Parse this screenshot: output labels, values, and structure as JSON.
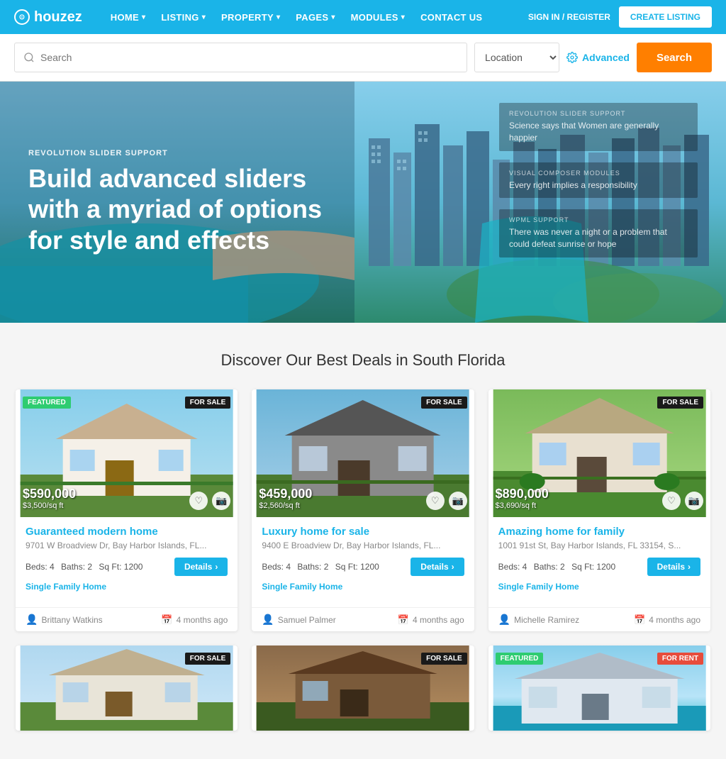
{
  "brand": {
    "name": "houzez",
    "logo_icon": "⊙"
  },
  "navbar": {
    "links": [
      {
        "label": "HOME",
        "has_dropdown": true
      },
      {
        "label": "LISTING",
        "has_dropdown": true
      },
      {
        "label": "PROPERTY",
        "has_dropdown": true
      },
      {
        "label": "PAGES",
        "has_dropdown": true
      },
      {
        "label": "MODULES",
        "has_dropdown": true
      },
      {
        "label": "CONTACT US",
        "has_dropdown": false
      }
    ],
    "sign_in_label": "SIGN IN / REGISTER",
    "create_listing_label": "CREATE LISTING"
  },
  "search_bar": {
    "placeholder": "Search",
    "location_label": "Location",
    "advanced_label": "Advanced",
    "search_button_label": "Search"
  },
  "hero": {
    "sub_label": "REVOLUTION SLIDER SUPPORT",
    "title": "Build advanced sliders with a myriad of options for style and effects",
    "panels": [
      {
        "sub": "REVOLUTION SLIDER SUPPORT",
        "title": "Science says that Women are generally happier"
      },
      {
        "sub": "VISUAL COMPOSER MODULES",
        "title": "Every right implies a responsibility"
      },
      {
        "sub": "WPML SUPPORT",
        "title": "There was never a night or a problem that could defeat sunrise or hope"
      }
    ]
  },
  "deals_section": {
    "title": "Discover Our Best Deals in South Florida"
  },
  "properties": [
    {
      "featured": true,
      "status": "FOR SALE",
      "price": "$590,000",
      "price_per_sqft": "$3,500/sq ft",
      "title": "Guaranteed modern home",
      "address": "9701 W Broadview Dr, Bay Harbor Islands, FL...",
      "beds": "4",
      "baths": "2",
      "sqft": "1200",
      "type": "Single Family Home",
      "agent": "Brittany Watkins",
      "time": "4 months ago",
      "details_label": "Details",
      "color": "#e8d5a0",
      "image_type": "white_house"
    },
    {
      "featured": false,
      "status": "FOR SALE",
      "price": "$459,000",
      "price_per_sqft": "$2,560/sq ft",
      "title": "Luxury home for sale",
      "address": "9400 E Broadview Dr, Bay Harbor Islands, FL...",
      "beds": "4",
      "baths": "2",
      "sqft": "1200",
      "type": "Single Family Home",
      "agent": "Samuel Palmer",
      "time": "4 months ago",
      "details_label": "Details",
      "color": "#c8d4b0",
      "image_type": "gray_house"
    },
    {
      "featured": false,
      "status": "FOR SALE",
      "price": "$890,000",
      "price_per_sqft": "$3,690/sq ft",
      "title": "Amazing home for family",
      "address": "1001 91st St, Bay Harbor Islands, FL 33154, S...",
      "beds": "4",
      "baths": "2",
      "sqft": "1200",
      "type": "Single Family Home",
      "agent": "Michelle Ramirez",
      "time": "4 months ago",
      "details_label": "Details",
      "color": "#b8c8a0",
      "image_type": "green_house"
    }
  ],
  "bottom_cards": [
    {
      "status": "FOR SALE",
      "featured": false,
      "color": "#d0c8b8",
      "image_type": "white_house2"
    },
    {
      "status": "FOR SALE",
      "featured": false,
      "color": "#8b7355",
      "image_type": "brown_house"
    },
    {
      "status": "FOR RENT",
      "featured": true,
      "color": "#87ceeb",
      "image_type": "beach_house"
    }
  ],
  "colors": {
    "primary": "#1ab4e8",
    "orange": "#ff7f00",
    "green": "#2ecc71",
    "dark": "#1a1a1a",
    "red": "#e74c3c"
  }
}
